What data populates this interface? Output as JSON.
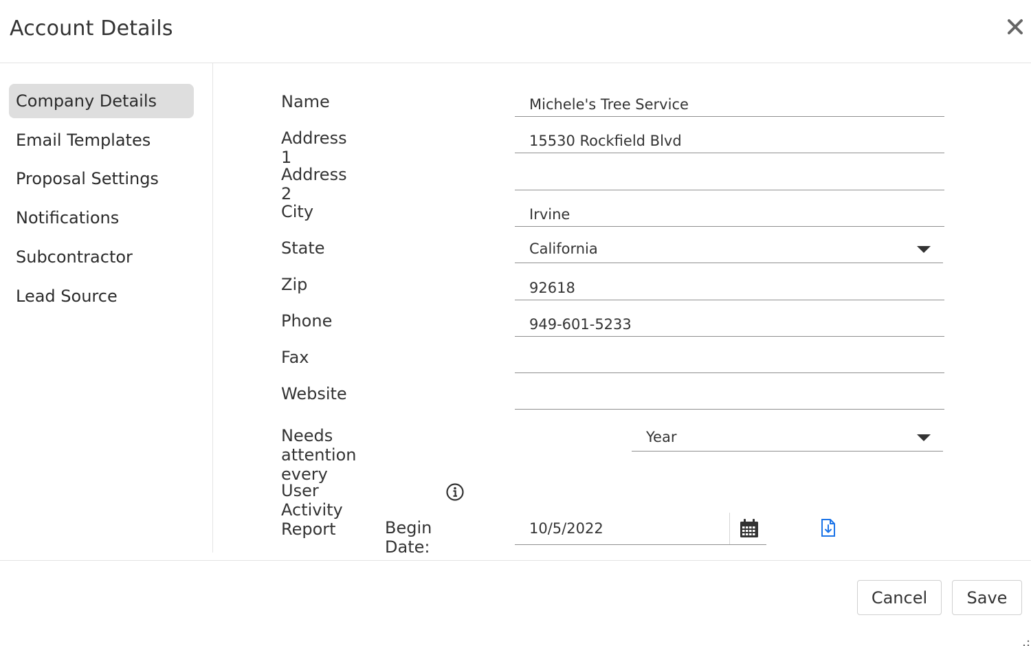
{
  "dialog": {
    "title": "Account Details",
    "close_icon": "close-icon"
  },
  "sidebar": {
    "items": [
      {
        "label": "Company Details",
        "active": true
      },
      {
        "label": "Email Templates",
        "active": false
      },
      {
        "label": "Proposal Settings",
        "active": false
      },
      {
        "label": "Notifications",
        "active": false
      },
      {
        "label": "Subcontractor",
        "active": false
      },
      {
        "label": "Lead Source",
        "active": false
      }
    ]
  },
  "form": {
    "name": {
      "label": "Name",
      "value": "Michele's Tree Service"
    },
    "address1": {
      "label": "Address 1",
      "value": "15530 Rockfield Blvd"
    },
    "address2": {
      "label": "Address 2",
      "value": ""
    },
    "city": {
      "label": "City",
      "value": "Irvine"
    },
    "state": {
      "label": "State",
      "value": "California"
    },
    "zip": {
      "label": "Zip",
      "value": "92618"
    },
    "phone": {
      "label": "Phone",
      "value": "949-601-5233"
    },
    "fax": {
      "label": "Fax",
      "value": ""
    },
    "website": {
      "label": "Website",
      "value": ""
    },
    "attention": {
      "label": "Needs attention every",
      "value": "Year"
    }
  },
  "report": {
    "title": "User Activity Report",
    "begin_label": "Begin Date:",
    "begin_value": "10/5/2022",
    "icons": {
      "info": "info-icon",
      "calendar": "calendar-icon",
      "download": "file-download-icon"
    }
  },
  "footer": {
    "cancel_label": "Cancel",
    "save_label": "Save"
  },
  "colors": {
    "accent": "#1a73e8",
    "active_nav_bg": "#dedede",
    "border": "#e3e3e3",
    "text": "#333333"
  }
}
